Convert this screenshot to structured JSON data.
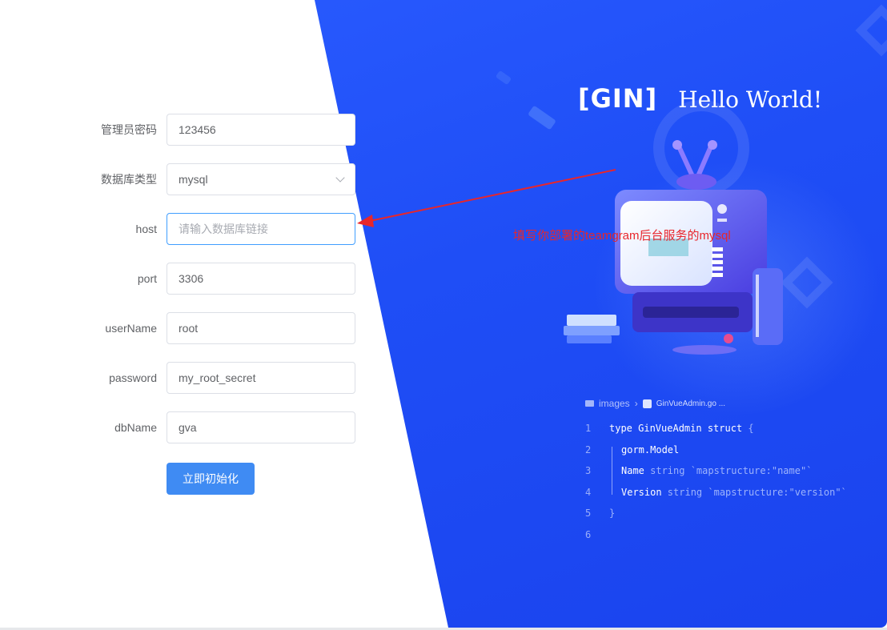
{
  "form": {
    "fields": [
      {
        "label": "管理员密码",
        "value": "123456",
        "placeholder": ""
      },
      {
        "label": "数据库类型",
        "value": "mysql",
        "placeholder": "",
        "type": "select"
      },
      {
        "label": "host",
        "value": "",
        "placeholder": "请输入数据库链接",
        "focused": true
      },
      {
        "label": "port",
        "value": "3306",
        "placeholder": ""
      },
      {
        "label": "userName",
        "value": "root",
        "placeholder": ""
      },
      {
        "label": "password",
        "value": "my_root_secret",
        "placeholder": ""
      },
      {
        "label": "dbName",
        "value": "gva",
        "placeholder": ""
      }
    ],
    "submit_label": "立即初始化"
  },
  "hero": {
    "logo": "[GIN]",
    "tagline": "Hello World!",
    "breadcrumb": {
      "folder": "images",
      "file": "GinVueAdmin.go ..."
    },
    "code": [
      {
        "n": "1",
        "parts": [
          [
            "kw",
            "type GinVueAdmin struct "
          ],
          [
            "dim",
            "{"
          ]
        ]
      },
      {
        "n": "2",
        "parts": [
          [
            "kw",
            "gorm.Model"
          ]
        ]
      },
      {
        "n": "3",
        "parts": [
          [
            "kw",
            "Name"
          ],
          [
            "dim",
            "    string `mapstructure:\"name\"`"
          ]
        ]
      },
      {
        "n": "4",
        "parts": [
          [
            "kw",
            "Version"
          ],
          [
            "dim",
            " string `mapstructure:\"version\"`"
          ]
        ]
      },
      {
        "n": "5",
        "parts": [
          [
            "dim",
            "}"
          ]
        ]
      },
      {
        "n": "6",
        "parts": []
      }
    ]
  },
  "annotation": {
    "text": "填写你部署的teamgram后台服务的mysql",
    "color": "#e8262b"
  },
  "colors": {
    "primary": "#3f8bf3",
    "hero_blue": "#1f4ef6",
    "focus_border": "#409eff"
  }
}
